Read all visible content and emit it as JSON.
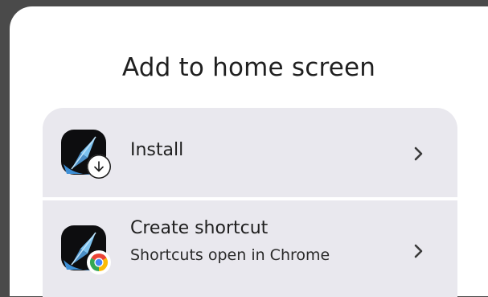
{
  "dialog": {
    "title": "Add to home screen",
    "options": [
      {
        "label": "Install",
        "subtitle": "",
        "icon": "compass-app-icon",
        "badge": "download-arrow-icon"
      },
      {
        "label": "Create shortcut",
        "subtitle": "Shortcuts open in Chrome",
        "icon": "compass-app-icon",
        "badge": "chrome-icon"
      }
    ]
  },
  "colors": {
    "sheet_background": "#ffffff",
    "option_background": "#e9e8ee",
    "scrim": "#4a4a4a",
    "text": "#1f1f1f"
  }
}
